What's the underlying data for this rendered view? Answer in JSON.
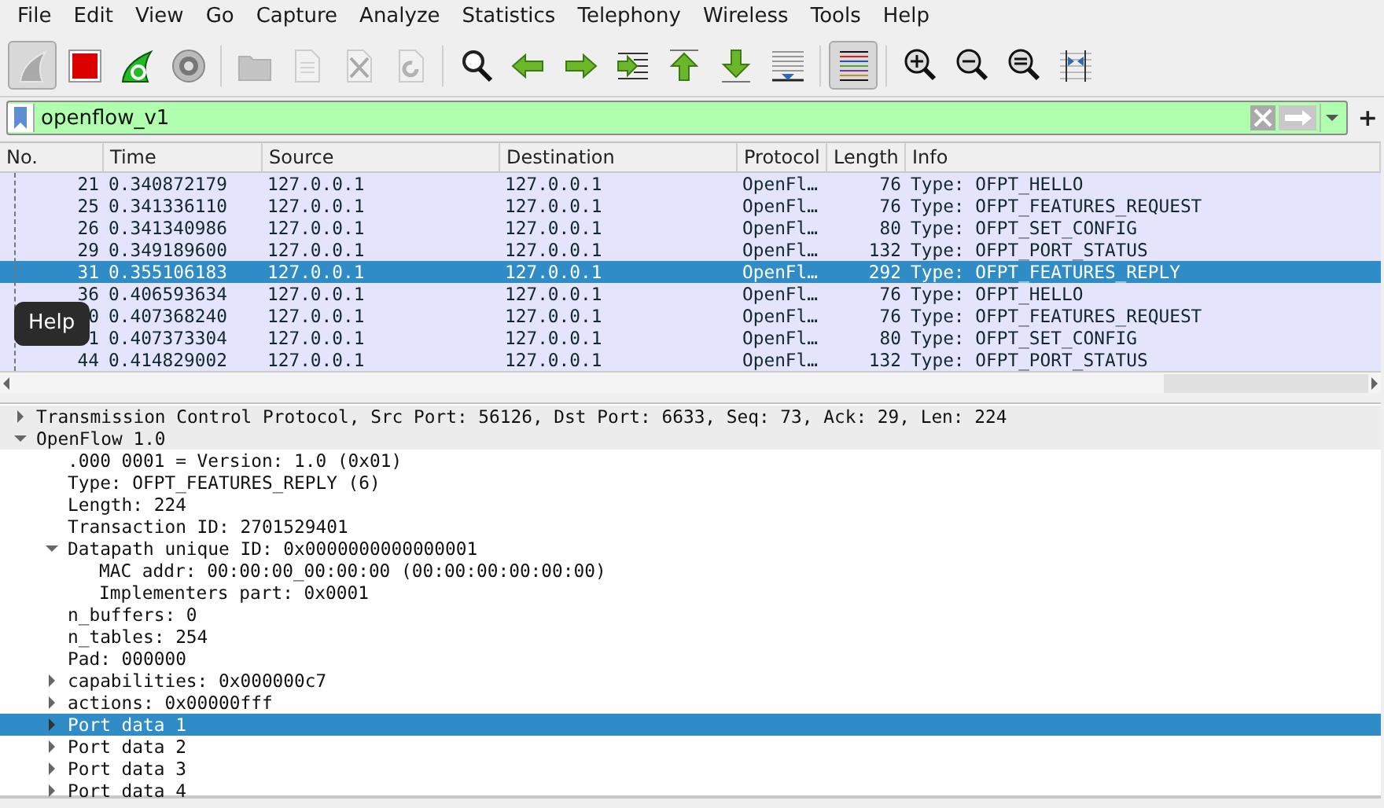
{
  "menu": [
    "File",
    "Edit",
    "View",
    "Go",
    "Capture",
    "Analyze",
    "Statistics",
    "Telephony",
    "Wireless",
    "Tools",
    "Help"
  ],
  "toolbar": [
    {
      "kind": "fin",
      "pressed": true,
      "disabled": false
    },
    {
      "kind": "stop",
      "pressed": false,
      "disabled": false
    },
    {
      "kind": "restart",
      "pressed": false,
      "disabled": false
    },
    {
      "kind": "gear",
      "pressed": false,
      "disabled": false
    },
    {
      "kind": "separator"
    },
    {
      "kind": "folder",
      "pressed": false,
      "disabled": true
    },
    {
      "kind": "file",
      "pressed": false,
      "disabled": true
    },
    {
      "kind": "file-x",
      "pressed": false,
      "disabled": true
    },
    {
      "kind": "file-reload",
      "pressed": false,
      "disabled": true
    },
    {
      "kind": "separator"
    },
    {
      "kind": "search",
      "pressed": false,
      "disabled": false
    },
    {
      "kind": "arrow-left",
      "pressed": false,
      "disabled": false
    },
    {
      "kind": "arrow-right",
      "pressed": false,
      "disabled": false
    },
    {
      "kind": "goto",
      "pressed": false,
      "disabled": false
    },
    {
      "kind": "arrow-up",
      "pressed": false,
      "disabled": false
    },
    {
      "kind": "arrow-down",
      "pressed": false,
      "disabled": false
    },
    {
      "kind": "autoscroll",
      "pressed": false,
      "disabled": false
    },
    {
      "kind": "separator"
    },
    {
      "kind": "colorize",
      "pressed": true,
      "disabled": false
    },
    {
      "kind": "separator"
    },
    {
      "kind": "zoom-in",
      "pressed": false,
      "disabled": false
    },
    {
      "kind": "zoom-out",
      "pressed": false,
      "disabled": false
    },
    {
      "kind": "zoom-reset",
      "pressed": false,
      "disabled": false
    },
    {
      "kind": "resize",
      "pressed": false,
      "disabled": false
    }
  ],
  "filter": {
    "value": "openflow_v1",
    "valid": true,
    "add_button": "+"
  },
  "packets": {
    "columns": [
      "No.",
      "Time",
      "Source",
      "Destination",
      "Protocol",
      "Length",
      "Info"
    ],
    "rows": [
      {
        "no": "21",
        "time": "0.340872179",
        "source": "127.0.0.1",
        "destination": "127.0.0.1",
        "protocol": "OpenFl…",
        "length": "76",
        "info": "Type: OFPT_HELLO",
        "selected": false
      },
      {
        "no": "25",
        "time": "0.341336110",
        "source": "127.0.0.1",
        "destination": "127.0.0.1",
        "protocol": "OpenFl…",
        "length": "76",
        "info": "Type: OFPT_FEATURES_REQUEST",
        "selected": false
      },
      {
        "no": "26",
        "time": "0.341340986",
        "source": "127.0.0.1",
        "destination": "127.0.0.1",
        "protocol": "OpenFl…",
        "length": "80",
        "info": "Type: OFPT_SET_CONFIG",
        "selected": false
      },
      {
        "no": "29",
        "time": "0.349189600",
        "source": "127.0.0.1",
        "destination": "127.0.0.1",
        "protocol": "OpenFl…",
        "length": "132",
        "info": "Type: OFPT_PORT_STATUS",
        "selected": false
      },
      {
        "no": "31",
        "time": "0.355106183",
        "source": "127.0.0.1",
        "destination": "127.0.0.1",
        "protocol": "OpenFl…",
        "length": "292",
        "info": "Type: OFPT_FEATURES_REPLY",
        "selected": true
      },
      {
        "no": "36",
        "time": "0.406593634",
        "source": "127.0.0.1",
        "destination": "127.0.0.1",
        "protocol": "OpenFl…",
        "length": "76",
        "info": "Type: OFPT_HELLO",
        "selected": false
      },
      {
        "no": "0",
        "time": "0.407368240",
        "source": "127.0.0.1",
        "destination": "127.0.0.1",
        "protocol": "OpenFl…",
        "length": "76",
        "info": "Type: OFPT_FEATURES_REQUEST",
        "selected": false
      },
      {
        "no": "1",
        "time": "0.407373304",
        "source": "127.0.0.1",
        "destination": "127.0.0.1",
        "protocol": "OpenFl…",
        "length": "80",
        "info": "Type: OFPT_SET_CONFIG",
        "selected": false
      },
      {
        "no": "44",
        "time": "0.414829002",
        "source": "127.0.0.1",
        "destination": "127.0.0.1",
        "protocol": "OpenFl…",
        "length": "132",
        "info": "Type: OFPT_PORT_STATUS",
        "selected": false
      }
    ]
  },
  "tooltip": {
    "text": "Help"
  },
  "details": [
    {
      "text": "Transmission Control Protocol, Src Port: 56126, Dst Port: 6633, Seq: 73, Ack: 29, Len: 224",
      "expanded": false,
      "selected": false
    },
    {
      "text": "OpenFlow 1.0",
      "expanded": true,
      "selected": false,
      "children": [
        {
          "text": ".000 0001 = Version: 1.0 (0x01)",
          "selected": false
        },
        {
          "text": "Type: OFPT_FEATURES_REPLY (6)",
          "selected": false
        },
        {
          "text": "Length: 224",
          "selected": false
        },
        {
          "text": "Transaction ID: 2701529401",
          "selected": false
        },
        {
          "text": "Datapath unique ID: 0x0000000000000001",
          "expanded": true,
          "selected": false,
          "children": [
            {
              "text": "MAC addr: 00:00:00_00:00:00 (00:00:00:00:00:00)",
              "selected": false
            },
            {
              "text": "Implementers part: 0x0001",
              "selected": false
            }
          ]
        },
        {
          "text": "n_buffers: 0",
          "selected": false
        },
        {
          "text": "n_tables: 254",
          "selected": false
        },
        {
          "text": "Pad: 000000",
          "selected": false
        },
        {
          "text": "capabilities: 0x000000c7",
          "expanded": false,
          "selected": false
        },
        {
          "text": "actions: 0x00000fff",
          "expanded": false,
          "selected": false
        },
        {
          "text": "Port data 1",
          "expanded": false,
          "selected": true
        },
        {
          "text": "Port data 2",
          "expanded": false,
          "selected": false
        },
        {
          "text": "Port data 3",
          "expanded": false,
          "selected": false
        },
        {
          "text": "Port data 4",
          "expanded": false,
          "selected": false
        }
      ]
    }
  ]
}
